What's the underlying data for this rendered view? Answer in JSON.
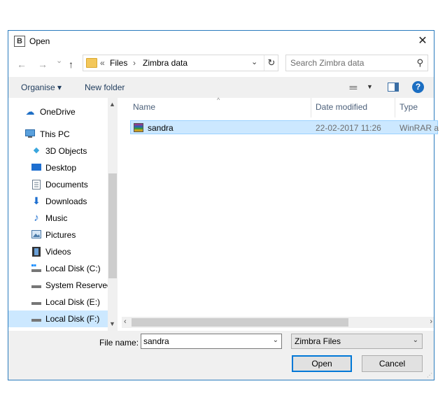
{
  "window": {
    "title": "Open",
    "app_icon_letter": "B",
    "close_glyph": "✕"
  },
  "nav": {
    "back_glyph": "←",
    "forward_glyph": "→",
    "recent_glyph": "⌄",
    "up_glyph": "↑",
    "address": {
      "prefix": "«",
      "crumb1": "Files",
      "sep": "›",
      "crumb2": "Zimbra data",
      "dropdown_glyph": "⌄",
      "refresh_glyph": "↻"
    },
    "search_placeholder": "Search Zimbra data"
  },
  "toolbar": {
    "organise": "Organise ▾",
    "new_folder": "New folder",
    "view_glyph": "≡≡",
    "view_dd": "▼",
    "help": "?"
  },
  "sidebar": {
    "items": [
      {
        "label": "OneDrive",
        "icon": "☁",
        "color": "#1f6fc5"
      },
      {
        "label": "This PC",
        "icon": "🖥",
        "color": "#2a7bbd"
      },
      {
        "label": "3D Objects",
        "icon": "◆",
        "color": "#3aa6dd"
      },
      {
        "label": "Desktop",
        "icon": "▬",
        "color": "#1e6fd0"
      },
      {
        "label": "Documents",
        "icon": "▤",
        "color": "#6b7d8e"
      },
      {
        "label": "Downloads",
        "icon": "⬇",
        "color": "#1e6fd0"
      },
      {
        "label": "Music",
        "icon": "♪",
        "color": "#1e6fd0"
      },
      {
        "label": "Pictures",
        "icon": "▣",
        "color": "#4a7aa8"
      },
      {
        "label": "Videos",
        "icon": "▦",
        "color": "#444444"
      },
      {
        "label": "Local Disk (C:)",
        "icon": "▭",
        "color": "#5a5a5a"
      },
      {
        "label": "System Reserved",
        "icon": "▭",
        "color": "#5a5a5a"
      },
      {
        "label": "Local Disk (E:)",
        "icon": "▭",
        "color": "#5a5a5a"
      },
      {
        "label": "Local Disk (F:)",
        "icon": "▭",
        "color": "#5a5a5a"
      }
    ]
  },
  "columns": {
    "name": "Name",
    "date": "Date modified",
    "type": "Type"
  },
  "files": [
    {
      "name": "sandra",
      "date": "22-02-2017 11:26",
      "type": "WinRAR archive"
    }
  ],
  "footer": {
    "file_name_label": "File name:",
    "file_name_value": "sandra",
    "file_type": "Zimbra Files",
    "open": "Open",
    "cancel": "Cancel"
  }
}
